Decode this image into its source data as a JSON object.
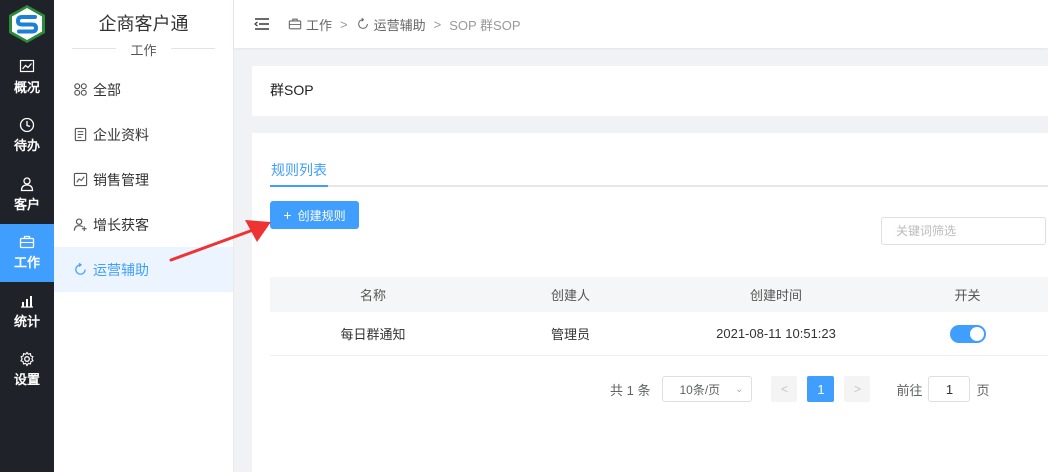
{
  "app": {
    "title": "企商客户通",
    "subtitle": "工作"
  },
  "rail": {
    "items": [
      {
        "label": "概况",
        "icon": "chart-line-icon"
      },
      {
        "label": "待办",
        "icon": "clock-icon"
      },
      {
        "label": "客户",
        "icon": "user-icon"
      },
      {
        "label": "工作",
        "icon": "briefcase-icon",
        "active": true
      },
      {
        "label": "统计",
        "icon": "bar-chart-icon"
      },
      {
        "label": "设置",
        "icon": "gear-icon"
      }
    ]
  },
  "menu": {
    "items": [
      {
        "label": "全部",
        "icon": "grid-icon"
      },
      {
        "label": "企业资料",
        "icon": "document-icon"
      },
      {
        "label": "销售管理",
        "icon": "chart-box-icon"
      },
      {
        "label": "增长获客",
        "icon": "user-add-icon"
      },
      {
        "label": "运营辅助",
        "icon": "refresh-icon",
        "active": true
      }
    ]
  },
  "breadcrumb": {
    "items": [
      "工作",
      "运营辅助",
      "SOP 群SOP"
    ],
    "separator": ">"
  },
  "page": {
    "title": "群SOP"
  },
  "tabs": {
    "active_label": "规则列表"
  },
  "toolbar": {
    "create_label": "创建规则",
    "create_icon": "+"
  },
  "search": {
    "placeholder": "关键词筛选"
  },
  "table": {
    "headers": [
      "名称",
      "创建人",
      "创建时间",
      "开关"
    ],
    "rows": [
      {
        "name": "每日群通知",
        "creator": "管理员",
        "created": "2021-08-11 10:51:23",
        "enabled": true
      }
    ]
  },
  "pagination": {
    "total": "共 1 条",
    "page_size": "10条/页",
    "current_page": "1",
    "goto_label": "前往",
    "goto_value": "1",
    "page_suffix": "页",
    "prev": "<",
    "next": ">"
  },
  "colors": {
    "accent": "#409eff",
    "rail_bg": "#1f2329",
    "annotation_arrow": "#ee3333"
  }
}
